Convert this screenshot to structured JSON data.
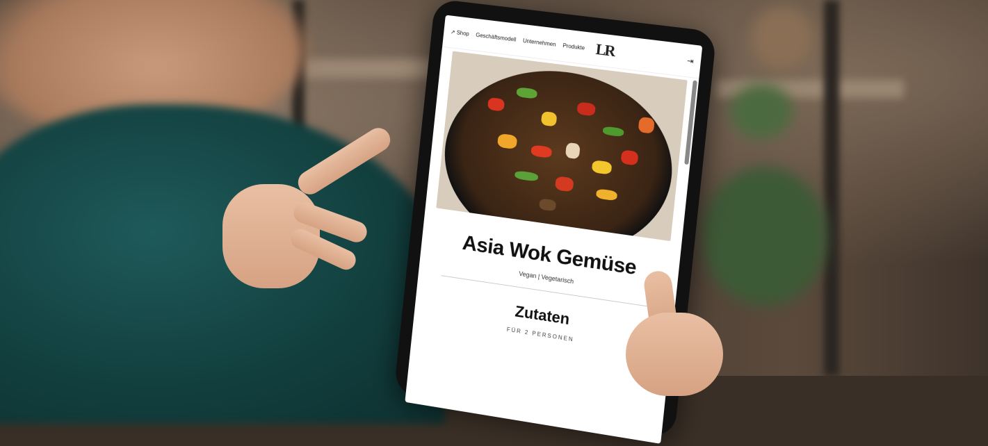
{
  "nav": {
    "items": [
      {
        "label": "Shop",
        "icon": "external-link-icon"
      },
      {
        "label": "Geschäftsmodell"
      },
      {
        "label": "Unternehmen"
      },
      {
        "label": "Produkte"
      }
    ],
    "logo_text": "LR",
    "login_icon": "login-icon"
  },
  "recipe": {
    "title": "Asia Wok Gemüse",
    "tags": "Vegan | Vegetarisch",
    "section_title": "Zutaten",
    "section_sub": "FÜR 2 PERSONEN"
  },
  "colors": {
    "sweater": "#12403f",
    "tablet_bezel": "#111111",
    "screen_bg": "#ffffff"
  }
}
